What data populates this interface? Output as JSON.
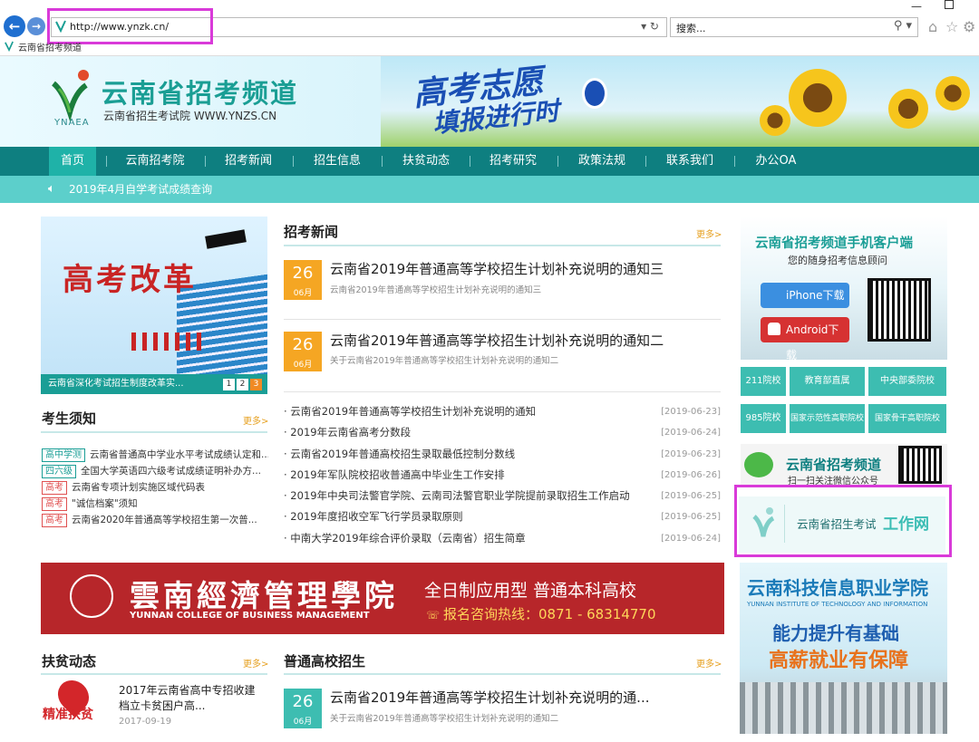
{
  "browser": {
    "url": "http://www.ynzk.cn/",
    "search_placeholder": "搜索...",
    "tab_title": "云南省招考频道"
  },
  "header": {
    "logo_text": "YNAEA",
    "title": "云南省招考频道",
    "subtitle": "云南省招生考试院 WWW.YNZS.CN",
    "banner_line1": "高考志愿",
    "banner_line2": "填报进行时"
  },
  "nav": {
    "items": [
      "首页",
      "云南招考院",
      "招考新闻",
      "招生信息",
      "扶贫动态",
      "招考研究",
      "政策法规",
      "联系我们",
      "办公OA"
    ]
  },
  "notice": "2019年4月自学考试成绩查询",
  "reform": {
    "title": "高考改革",
    "caption": "云南省深化考试招生制度改革实...",
    "pages": [
      "1",
      "2",
      "3"
    ]
  },
  "news": {
    "heading": "招考新闻",
    "more": "更多>",
    "featured": [
      {
        "day": "26",
        "month": "06月",
        "title": "云南省2019年普通高等学校招生计划补充说明的通知三",
        "sub": "云南省2019年普通高等学校招生计划补充说明的通知三"
      },
      {
        "day": "26",
        "month": "06月",
        "title": "云南省2019年普通高等学校招生计划补充说明的通知二",
        "sub": "关于云南省2019年普通高等学校招生计划补充说明的通知二"
      }
    ],
    "list": [
      {
        "title": "· 云南省2019年普通高等学校招生计划补充说明的通知",
        "date": "[2019-06-23]"
      },
      {
        "title": "· 2019年云南省高考分数段",
        "date": "[2019-06-24]"
      },
      {
        "title": "· 云南省2019年普通高校招生录取最低控制分数线",
        "date": "[2019-06-23]"
      },
      {
        "title": "· 2019年军队院校招收普通高中毕业生工作安排",
        "date": "[2019-06-26]"
      },
      {
        "title": "· 2019年中央司法警官学院、云南司法警官职业学院提前录取招生工作启动",
        "date": "[2019-06-25]"
      },
      {
        "title": "· 2019年度招收空军飞行学员录取原则",
        "date": "[2019-06-25]"
      },
      {
        "title": "· 中南大学2019年综合评价录取（云南省）招生简章",
        "date": "[2019-06-24]"
      }
    ]
  },
  "notes": {
    "heading": "考生须知",
    "more": "更多>",
    "items": [
      {
        "tag": "高中学测",
        "text": "云南省普通高中学业水平考试成绩认定和..."
      },
      {
        "tag": "四六级",
        "text": "全国大学英语四六级考试成绩证明补办方..."
      },
      {
        "tag": "高考",
        "text": "云南省专项计划实施区域代码表"
      },
      {
        "tag": "高考",
        "text": "\"诚信档案\"须知"
      },
      {
        "tag": "高考",
        "text": "云南省2020年普通高等学校招生第一次普..."
      }
    ]
  },
  "poverty": {
    "heading": "扶贫动态",
    "more": "更多>",
    "logo_text": "精准扶贫",
    "item_title": "2017年云南省高中专招收建档立卡贫困户高...",
    "item_date": "2017-09-19"
  },
  "colleges": {
    "heading": "普通高校招生",
    "more": "更多>",
    "item": {
      "day": "26",
      "month": "06月",
      "title": "云南省2019年普通高等学校招生计划补充说明的通...",
      "sub": "关于云南省2019年普通高等学校招生计划补充说明的通知二"
    }
  },
  "app": {
    "title": "云南省招考频道手机客户端",
    "subtitle": "您的随身招考信息顾问",
    "ios": "iPhone下载",
    "android": "Android下载"
  },
  "tiles": [
    "211院校",
    "教育部直属",
    "中央部委院校",
    "985院校",
    "国家示范性高职院校",
    "国家骨干高职院校"
  ],
  "wechat": {
    "title": "云南省招考频道",
    "sub": "扫一扫关注微信公众号"
  },
  "work_site": {
    "prefix": "云南省招生考试",
    "highlight": "工作网"
  },
  "ad": {
    "school_cn": "雲南經濟管理學院",
    "school_en": "YUNNAN COLLEGE OF BUSINESS MANAGEMENT",
    "slogan": "全日制应用型 普通本科高校",
    "hotline": "报名咨询热线：0871 - 68314770"
  },
  "ynic": {
    "name": "云南科技信息职业学院",
    "en": "YUNNAN INSTITUTE OF TECHNOLOGY AND INFORMATION",
    "line1": "能力提升有基础",
    "line2": "高薪就业有保障"
  },
  "colors": {
    "teal": "#0e7f80",
    "accent": "#1fb2a8",
    "orange": "#f5a623",
    "red": "#b7262a",
    "highlight": "#d93ad9"
  }
}
